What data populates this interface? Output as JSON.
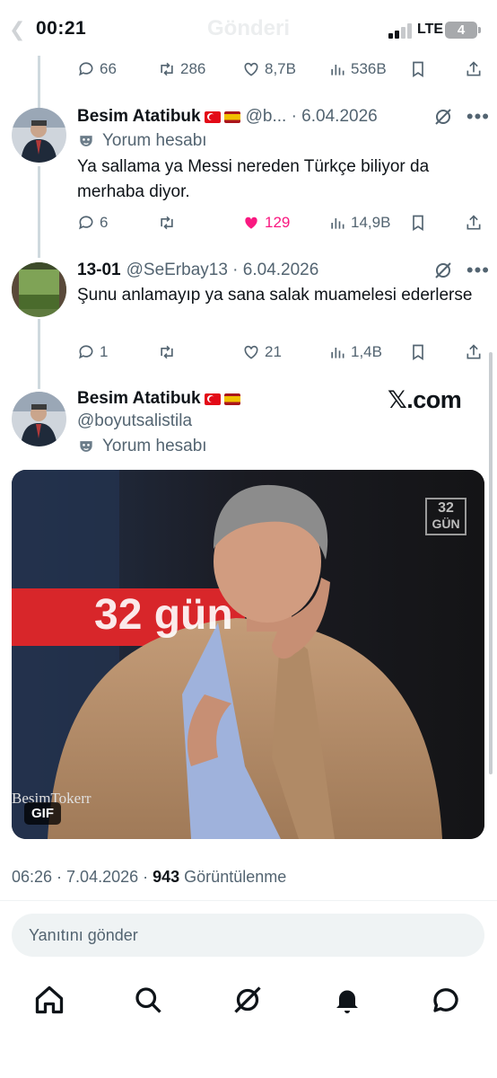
{
  "status_bar": {
    "time": "00:21",
    "title": "Gönderi",
    "network": "LTE",
    "battery": "4"
  },
  "top_stats": {
    "replies": "66",
    "reposts": "286",
    "likes": "8,7B",
    "views": "536B"
  },
  "tweets": [
    {
      "name": "Besim Atatibuk",
      "handle": "@b... · 6.04.2026",
      "label": "Yorum hesabı",
      "text": "Ya sallama ya Messi nereden Türkçe biliyor da merhaba diyor.",
      "replies": "6",
      "reposts": "",
      "likes": "129",
      "views": "14,9B"
    },
    {
      "name": "13-01",
      "handle": "@SeErbay13 · 6.04.2026",
      "text": "Şunu anlamayıp ya sana salak muamelesi ederlerse",
      "replies": "1",
      "reposts": "",
      "likes": "21",
      "views": "1,4B"
    }
  ],
  "main_tweet": {
    "name": "Besim Atatibuk",
    "handle": "@boyutsalistila",
    "label": "Yorum hesabı",
    "source": "𝕏.com",
    "media_badge": "GIF",
    "media_caption": "32 gün",
    "media_watermark": "BesimTokerr",
    "media_logo_top": "32",
    "media_logo_bottom": "GÜN",
    "time": "06:26 · 7.04.2026 · ",
    "views_count": "943",
    "views_label": " Görüntülenme"
  },
  "reply": {
    "placeholder": "Yanıtını gönder"
  },
  "colors": {
    "like_active": "#f91880",
    "muted": "#536471",
    "text": "#0f1419"
  },
  "tab_icons": [
    "home-icon",
    "search-icon",
    "grok-icon",
    "notifications-icon",
    "messages-icon"
  ]
}
